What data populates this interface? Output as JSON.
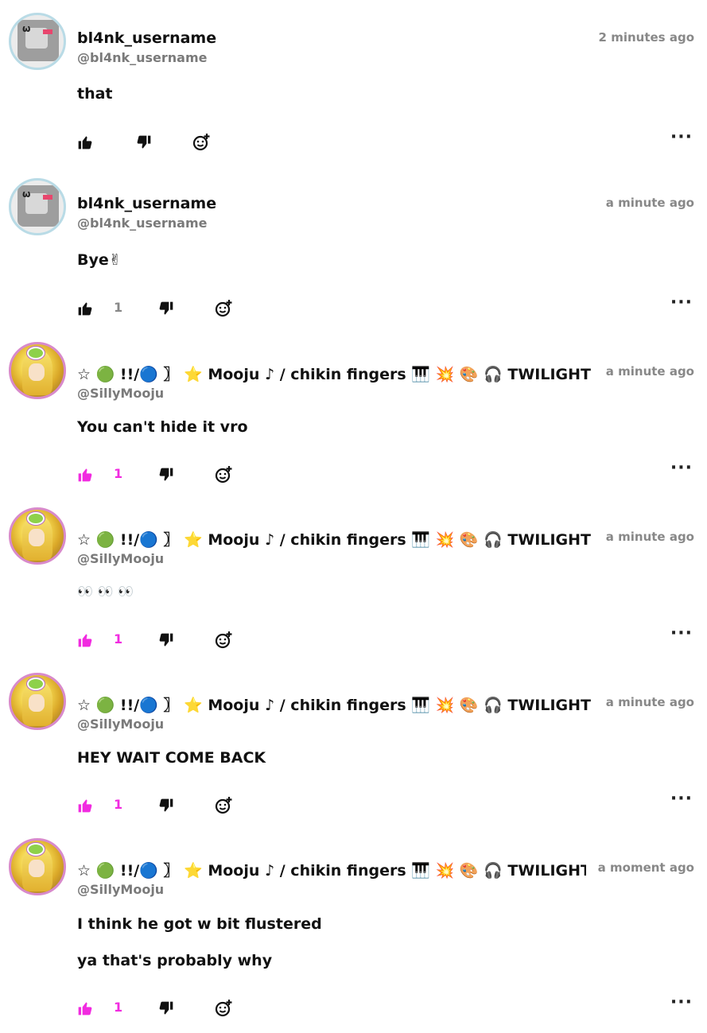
{
  "colors": {
    "liked": "#f12be0",
    "neutral": "#111111",
    "muted": "#888888"
  },
  "icons": {
    "like": "thumbs-up-icon",
    "dislike": "thumbs-down-icon",
    "react": "add-emoji-icon",
    "more": "more-options-icon"
  },
  "comments": [
    {
      "username": "bl4nk_username",
      "handle": "@bl4nk_username",
      "time": "2 minutes ago",
      "lines": [
        "that"
      ],
      "likes": "",
      "liked": false,
      "avatar": "blank"
    },
    {
      "username": "bl4nk_username",
      "handle": "@bl4nk_username",
      "time": "a minute ago",
      "lines": [
        "Bye✌"
      ],
      "likes": "1",
      "liked": false,
      "avatar": "blank"
    },
    {
      "username": "☆ 🟢 !!/🔵 〗 ⭐ Mooju ♪ / chikin fingers 🎹 💥 🎨 🎧  TWILIGHT SPA",
      "handle": "@SillyMooju",
      "time": "a minute ago",
      "lines": [
        "You can't hide it vro"
      ],
      "likes": "1",
      "liked": true,
      "avatar": "mooju"
    },
    {
      "username": "☆ 🟢 !!/🔵 〗 ⭐ Mooju ♪ / chikin fingers 🎹 💥 🎨 🎧  TWILIGHT SPA",
      "handle": "@SillyMooju",
      "time": "a minute ago",
      "lines": [
        "👀 👀 👀"
      ],
      "likes": "1",
      "liked": true,
      "avatar": "mooju"
    },
    {
      "username": "☆ 🟢 !!/🔵 〗 ⭐ Mooju ♪ / chikin fingers 🎹 💥 🎨 🎧  TWILIGHT SPA",
      "handle": "@SillyMooju",
      "time": "a minute ago",
      "lines": [
        "HEY WAIT COME BACK"
      ],
      "likes": "1",
      "liked": true,
      "avatar": "mooju"
    },
    {
      "username": "☆ 🟢 !!/🔵 〗 ⭐ Mooju ♪ / chikin fingers 🎹 💥 🎨 🎧  TWILIGHT SP",
      "handle": "@SillyMooju",
      "time": "a moment ago",
      "lines": [
        "I think he got w bit flustered",
        "ya that's probably why"
      ],
      "likes": "1",
      "liked": true,
      "avatar": "mooju"
    }
  ],
  "more_label": "···"
}
